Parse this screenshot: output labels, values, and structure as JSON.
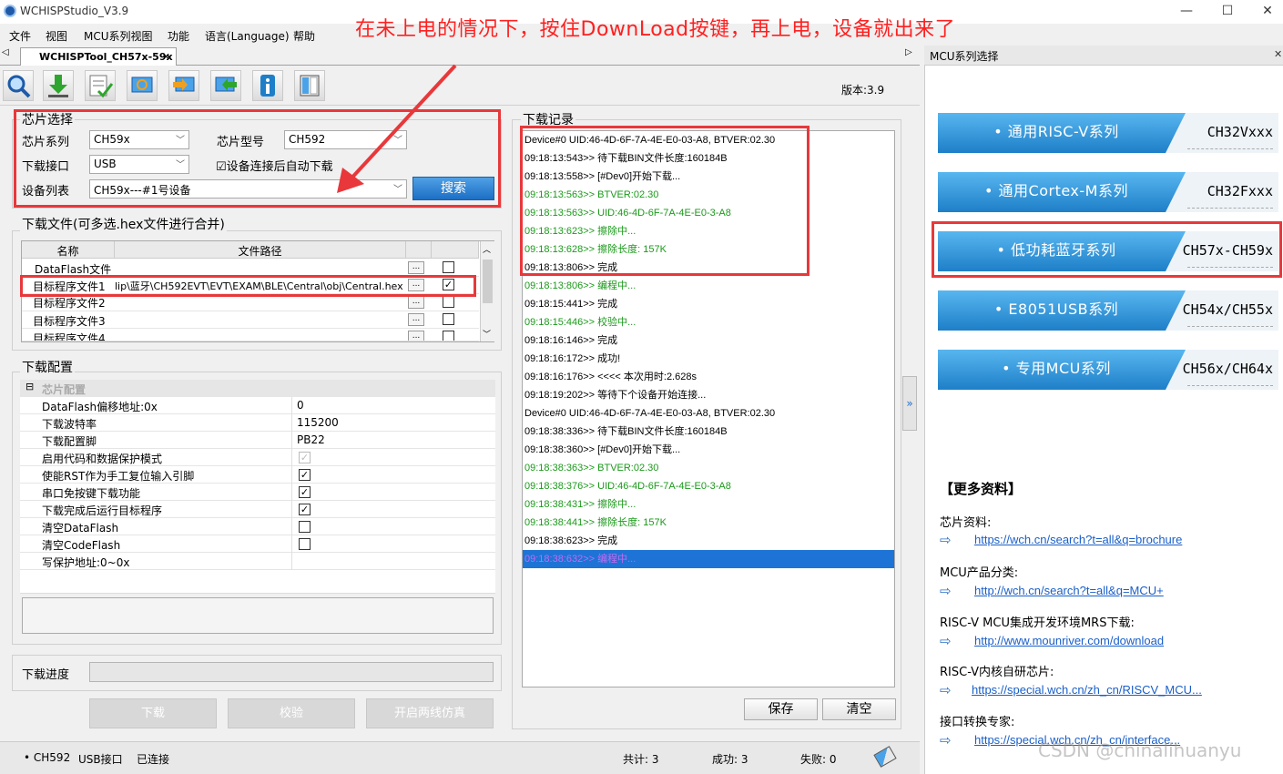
{
  "window": {
    "title": "WCHISPStudio_V3.9",
    "minimize": "—",
    "maximize": "☐",
    "close": "✕"
  },
  "annotation": "在未上电的情况下，按住DownLoad按键，再上电，设备就出来了",
  "menu": [
    "文件",
    "视图",
    "MCU系列视图",
    "功能",
    "语言(Language)",
    "帮助"
  ],
  "tab": {
    "label": "WCHISPTool_CH57x-59x",
    "close": "✕"
  },
  "version": "版本:3.9",
  "chip_select": {
    "group_label": "芯片选择",
    "series_label": "芯片系列",
    "series_value": "CH59x",
    "model_label": "芯片型号",
    "model_value": "CH592",
    "iface_label": "下载接口",
    "iface_value": "USB",
    "auto_label": "设备连接后自动下载",
    "auto_checked": "☑",
    "device_label": "设备列表",
    "device_value": "CH59x---#1号设备",
    "search_label": "搜索"
  },
  "download_files": {
    "group_label": "下载文件(可多选.hex文件进行合并)",
    "col_name": "名称",
    "col_path": "文件路径",
    "rows": [
      {
        "name": "DataFlash文件",
        "path": "",
        "checked": ""
      },
      {
        "name": "目标程序文件1",
        "path": "lip\\蓝牙\\CH592EVT\\EVT\\EXAM\\BLE\\Central\\obj\\Central.hex",
        "checked": "✓"
      },
      {
        "name": "目标程序文件2",
        "path": "",
        "checked": ""
      },
      {
        "name": "目标程序文件3",
        "path": "",
        "checked": ""
      },
      {
        "name": "目标程序文件4",
        "path": "",
        "checked": ""
      }
    ],
    "dots": "..."
  },
  "download_config": {
    "group_label": "下载配置",
    "section": "芯片配置",
    "props": [
      {
        "k": "DataFlash偏移地址:0x",
        "v": "0"
      },
      {
        "k": "下载波特率",
        "v": "115200"
      },
      {
        "k": "下载配置脚",
        "v": "PB22"
      },
      {
        "k": "启用代码和数据保护模式",
        "v": "✓"
      },
      {
        "k": "使能RST作为手工复位输入引脚",
        "v": "✓"
      },
      {
        "k": "串口免按键下载功能",
        "v": "✓"
      },
      {
        "k": "下载完成后运行目标程序",
        "v": "✓"
      },
      {
        "k": "清空DataFlash",
        "v": ""
      },
      {
        "k": "清空CodeFlash",
        "v": ""
      },
      {
        "k": "写保护地址:0~0x",
        "v": ""
      }
    ]
  },
  "progress_label": "下载进度",
  "progress_value": 0,
  "buttons": {
    "download": "下载",
    "verify": "校验",
    "emulate": "开启两线仿真",
    "save": "保存",
    "clear": "清空"
  },
  "log": {
    "label": "下载记录",
    "lines": [
      {
        "t": "Device#0 UID:46-4D-6F-7A-4E-E0-03-A8, BTVER:02.30",
        "c": ""
      },
      {
        "t": "09:18:13:543>> 待下载BIN文件长度:160184B",
        "c": ""
      },
      {
        "t": "09:18:13:558>> [#Dev0]开始下载...",
        "c": ""
      },
      {
        "t": "09:18:13:563>> BTVER:02.30",
        "c": "g"
      },
      {
        "t": "09:18:13:563>> UID:46-4D-6F-7A-4E-E0-3-A8",
        "c": "g"
      },
      {
        "t": "09:18:13:623>> 擦除中...",
        "c": "g"
      },
      {
        "t": "09:18:13:628>> 擦除长度: 157K",
        "c": "g"
      },
      {
        "t": "09:18:13:806>> 完成",
        "c": ""
      },
      {
        "t": "09:18:13:806>> 编程中...",
        "c": "g"
      },
      {
        "t": "09:18:15:441>> 完成",
        "c": ""
      },
      {
        "t": "09:18:15:446>> 校验中...",
        "c": "g"
      },
      {
        "t": "09:18:16:146>> 完成",
        "c": ""
      },
      {
        "t": "09:18:16:172>> 成功!",
        "c": ""
      },
      {
        "t": "09:18:16:176>> <<<< 本次用时:2.628s",
        "c": ""
      },
      {
        "t": "09:18:19:202>> 等待下个设备开始连接...",
        "c": ""
      },
      {
        "t": "Device#0 UID:46-4D-6F-7A-4E-E0-03-A8, BTVER:02.30",
        "c": ""
      },
      {
        "t": "09:18:38:336>> 待下载BIN文件长度:160184B",
        "c": ""
      },
      {
        "t": "09:18:38:360>> [#Dev0]开始下载...",
        "c": ""
      },
      {
        "t": "09:18:38:363>> BTVER:02.30",
        "c": "g"
      },
      {
        "t": "09:18:38:376>> UID:46-4D-6F-7A-4E-E0-3-A8",
        "c": "g"
      },
      {
        "t": "09:18:38:431>> 擦除中...",
        "c": "g"
      },
      {
        "t": "09:18:38:441>> 擦除长度: 157K",
        "c": "g"
      },
      {
        "t": "09:18:38:623>> 完成",
        "c": ""
      },
      {
        "t": "09:18:38:632>> 编程中...",
        "c": "hl"
      }
    ]
  },
  "status": {
    "chip": "• CH592",
    "iface": "USB接口",
    "conn": "已连接",
    "total": "共计: 3",
    "success": "成功: 3",
    "fail": "失败: 0"
  },
  "right": {
    "header": "MCU系列选择",
    "pin": "✕",
    "cards": [
      {
        "l": "• 通用RISC-V系列",
        "r": "CH32Vxxx"
      },
      {
        "l": "• 通用Cortex-M系列",
        "r": "CH32Fxxx"
      },
      {
        "l": "• 低功耗蓝牙系列",
        "r": "CH57x-CH59x"
      },
      {
        "l": "• E8051USB系列",
        "r": "CH54x/CH55x"
      },
      {
        "l": "• 专用MCU系列",
        "r": "CH56x/CH64x"
      }
    ],
    "more": "【更多资料】",
    "links": [
      {
        "label": "芯片资料:",
        "url": "https://wch.cn/search?t=all&q=brochure"
      },
      {
        "label": "MCU产品分类:",
        "url": "http://wch.cn/search?t=all&q=MCU+"
      },
      {
        "label": "RISC-V MCU集成开发环境MRS下载:",
        "url": "http://www.mounriver.com/download"
      },
      {
        "label": "RISC-V内核自研芯片:",
        "url": "https://special.wch.cn/zh_cn/RISCV_MCU..."
      },
      {
        "label": "接口转换专家:",
        "url": "https://special.wch.cn/zh_cn/interface..."
      }
    ],
    "watermark": "CSDN @chinalihuanyu"
  },
  "colors": {
    "accent": "#1e7fc8",
    "highlight": "#e8383b",
    "log_green": "#1a9a1a"
  }
}
